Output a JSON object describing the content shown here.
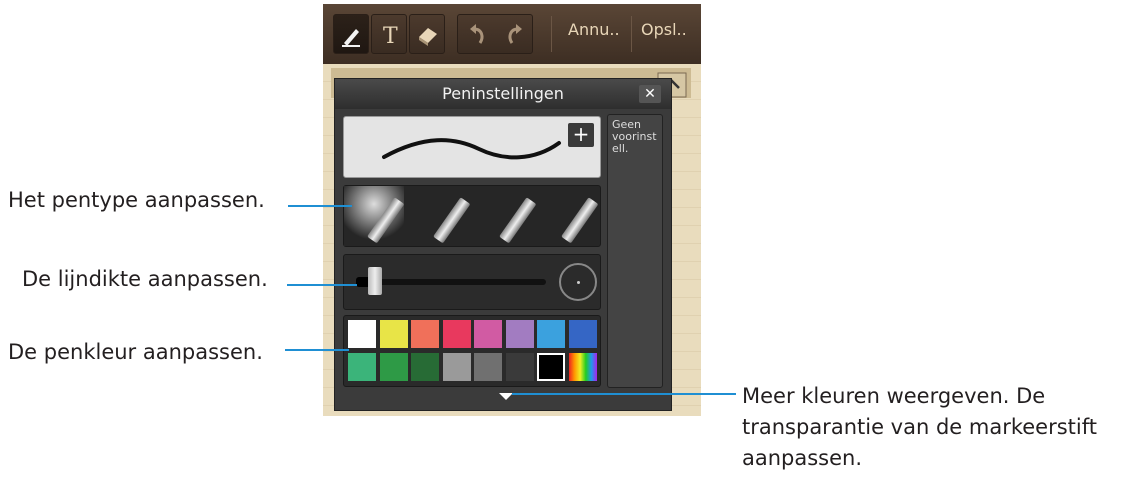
{
  "toolbar": {
    "cancel_label": "Annu..",
    "save_label": "Opsl.."
  },
  "panel": {
    "title": "Peninstellingen",
    "close_icon": "✕",
    "add_preset_icon": "+",
    "preset_text": "Geen voorinst ell."
  },
  "palette": {
    "row1": [
      "#ffffff",
      "#e8e447",
      "#f0705a",
      "#e8395e",
      "#d15ba3",
      "#a27cc1",
      "#3ba1de",
      "#3566c5"
    ],
    "row2": [
      "#3bb47a",
      "#2e9a46",
      "#276b35",
      "#9a9a9a",
      "#707070",
      "#3a3a3a",
      "#000000",
      "rainbow"
    ]
  },
  "callouts": {
    "pen_type": "Het pentype aanpassen.",
    "line_width": "De lijndikte aanpassen.",
    "pen_color": "De penkleur aanpassen.",
    "more_colors_line1": "Meer kleuren weergeven. De",
    "more_colors_line2": "transparantie van de markeerstift",
    "more_colors_line3": "aanpassen."
  },
  "colors": {
    "callout_line": "#1f8fd3"
  },
  "icons": {
    "pen": "pen-icon",
    "text": "text-icon",
    "eraser": "eraser-icon",
    "undo": "undo-icon",
    "redo": "redo-icon",
    "close": "close-icon",
    "add": "plus-icon",
    "expand": "chevron-down-icon"
  }
}
